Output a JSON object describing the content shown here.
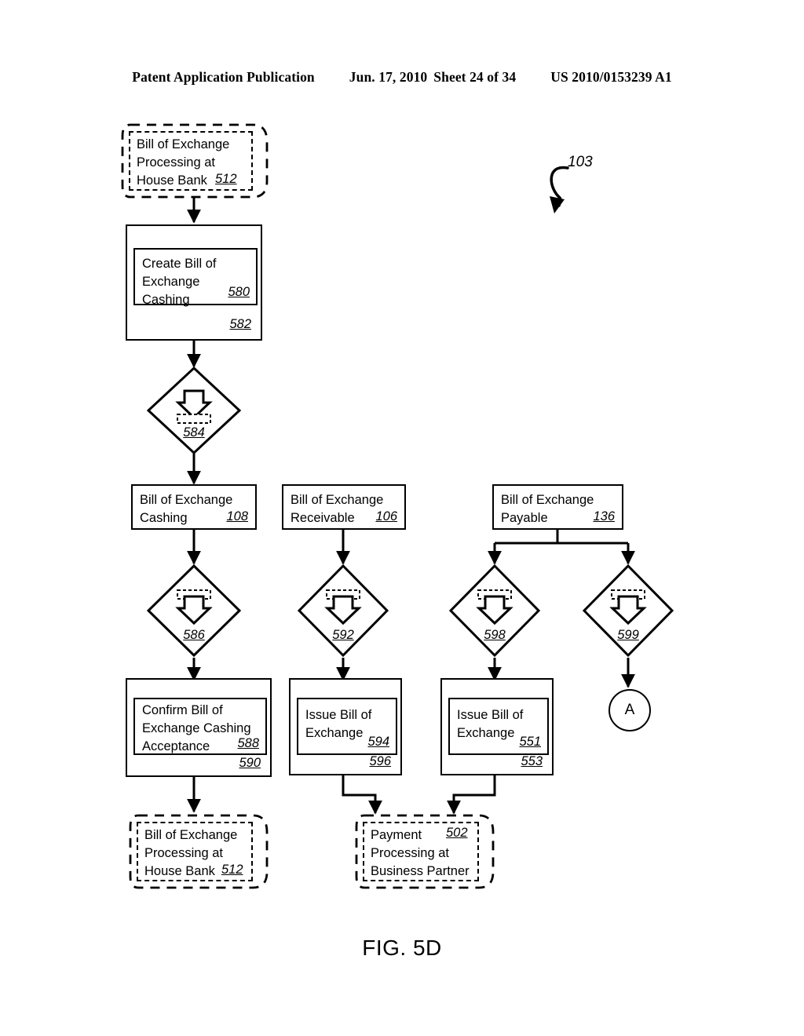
{
  "header": {
    "publication": "Patent Application Publication",
    "date": "Jun. 17, 2010",
    "sheet": "Sheet 24 of 34",
    "patent_number": "US 2010/0153239 A1"
  },
  "figure": {
    "caption": "FIG. 5D",
    "diagram_ref": "103"
  },
  "nodes": {
    "top_event": {
      "text": "Bill of Exchange\nProcessing at\nHouse Bank",
      "ref": "512",
      "type": "dashed-event"
    },
    "create_cashing": {
      "text": "Create Bill of\nExchange Cashing",
      "ref": "580",
      "outer_ref": "582",
      "type": "nested-process"
    },
    "diamond_584": {
      "ref": "584",
      "icon": "inbound-message-icon",
      "type": "diamond"
    },
    "boe_cashing": {
      "text": "Bill of Exchange\nCashing",
      "ref": "108",
      "type": "plain-box"
    },
    "boe_receivable": {
      "text": "Bill of Exchange\nReceivable",
      "ref": "106",
      "type": "plain-box"
    },
    "boe_payable": {
      "text": "Bill of Exchange\nPayable",
      "ref": "136",
      "type": "plain-box"
    },
    "diamond_586": {
      "ref": "586",
      "icon": "outbound-message-icon",
      "type": "diamond"
    },
    "diamond_592": {
      "ref": "592",
      "icon": "outbound-message-icon",
      "type": "diamond"
    },
    "diamond_598": {
      "ref": "598",
      "icon": "outbound-message-icon",
      "type": "diamond"
    },
    "diamond_599": {
      "ref": "599",
      "icon": "outbound-message-icon",
      "type": "diamond"
    },
    "confirm_acceptance": {
      "text": "Confirm Bill of\nExchange Cashing\nAcceptance",
      "ref": "588",
      "outer_ref": "590",
      "type": "nested-process"
    },
    "issue_boe_594": {
      "text": "Issue Bill of\nExchange",
      "ref": "594",
      "outer_ref": "596",
      "type": "nested-process"
    },
    "issue_boe_551": {
      "text": "Issue Bill of\nExchange",
      "ref": "551",
      "outer_ref": "553",
      "type": "nested-process"
    },
    "bottom_event_house_bank": {
      "text": "Bill of Exchange\nProcessing at\nHouse Bank",
      "ref": "512",
      "type": "dashed-event"
    },
    "payment_processing": {
      "text": "Payment\nProcessing at\nBusiness Partner",
      "ref": "502",
      "type": "dashed-event"
    },
    "connector_a": {
      "label": "A",
      "type": "off-page-connector"
    }
  },
  "colors": {
    "stroke": "#000000",
    "background": "#ffffff"
  }
}
